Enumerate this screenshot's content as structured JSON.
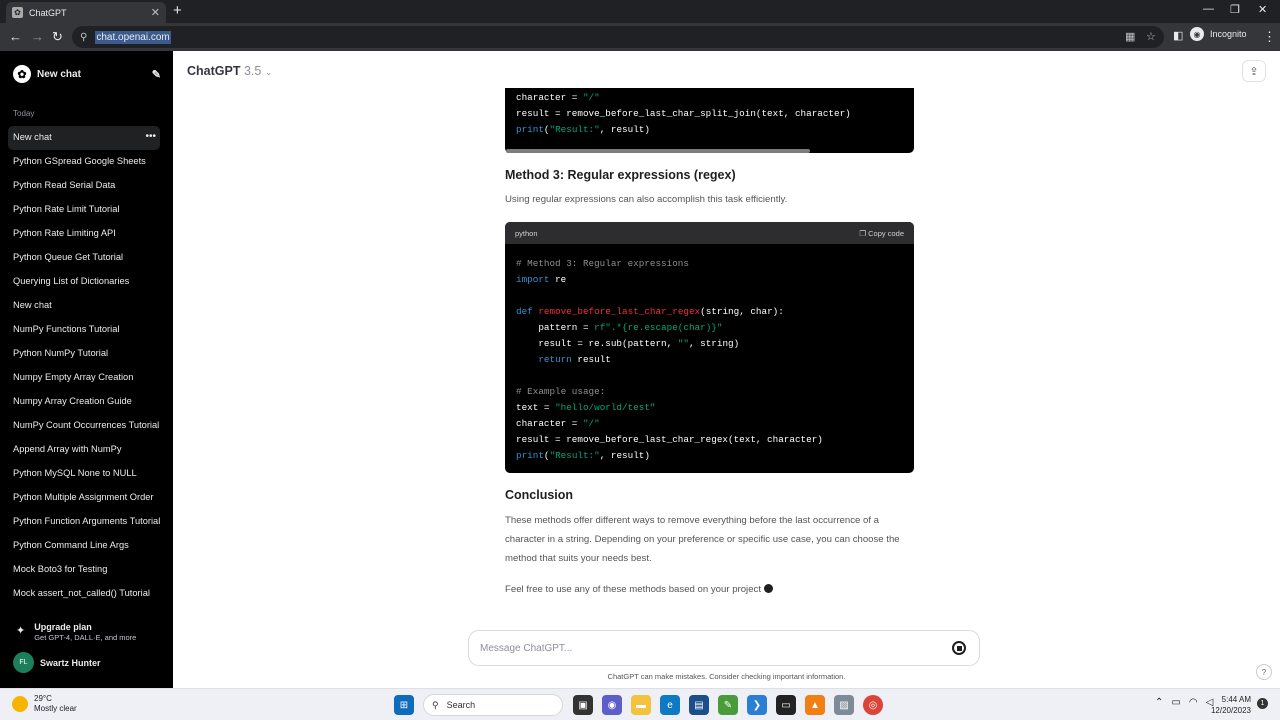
{
  "browser": {
    "tab_title": "ChatGPT",
    "url": "chat.openai.com",
    "incognito_label": "Incognito"
  },
  "sidebar": {
    "new_chat_label": "New chat",
    "section_label": "Today",
    "items": [
      "New chat",
      "Python GSpread Google Sheets",
      "Python Read Serial Data",
      "Python Rate Limit Tutorial",
      "Python Rate Limiting API",
      "Python Queue Get Tutorial",
      "Querying List of Dictionaries",
      "New chat",
      "NumPy Functions Tutorial",
      "Python NumPy Tutorial",
      "Numpy Empty Array Creation",
      "Numpy Array Creation Guide",
      "NumPy Count Occurrences Tutorial",
      "Append Array with NumPy",
      "Python MySQL None to NULL",
      "Python Multiple Assignment Order",
      "Python Function Arguments Tutorial",
      "Python Command Line Args",
      "Mock Boto3 for Testing",
      "Mock assert_not_called() Tutorial"
    ],
    "upgrade_title": "Upgrade plan",
    "upgrade_subtitle": "Get GPT-4, DALL·E, and more",
    "user_initials": "FL",
    "user_name": "Swartz Hunter"
  },
  "header": {
    "model": "ChatGPT",
    "version": "3.5"
  },
  "content": {
    "method3_heading": "Method 3: Regular expressions (regex)",
    "method3_text": "Using regular expressions can also accomplish this task efficiently.",
    "code_lang": "python",
    "copy_label": "Copy code",
    "conclusion_heading": "Conclusion",
    "conclusion_text": "These methods offer different ways to remove everything before the last occurrence of a character in a string. Depending on your preference or specific use case, you can choose the method that suits your needs best.",
    "final_text": "Feel free to use any of these methods based on your project"
  },
  "composer": {
    "placeholder": "Message ChatGPT...",
    "disclaimer": "ChatGPT can make mistakes. Consider checking important information."
  },
  "taskbar": {
    "temp": "29°C",
    "weather": "Mostly clear",
    "search_label": "Search",
    "time": "5:44 AM",
    "date": "12/20/2023",
    "notifications": "1"
  }
}
